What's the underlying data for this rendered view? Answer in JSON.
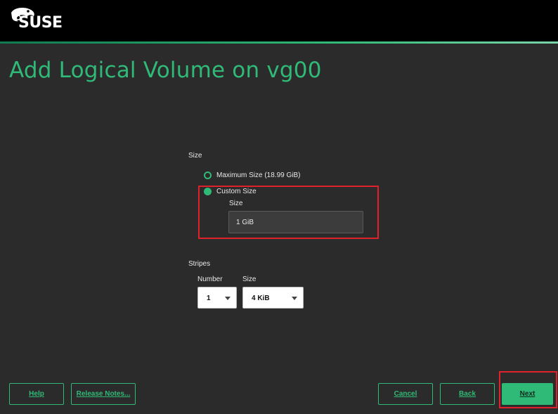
{
  "header": {
    "logo_text": "SUSE",
    "brand_color": "#30ba78"
  },
  "title": "Add Logical Volume on vg00",
  "size_section": {
    "label": "Size",
    "options": [
      {
        "label": "Maximum Size (18.99 GiB)",
        "selected": false
      },
      {
        "label": "Custom Size",
        "selected": true
      }
    ],
    "custom_size_label": "Size",
    "custom_size_value": "1 GiB"
  },
  "stripes_section": {
    "label": "Stripes",
    "number_label": "Number",
    "number_value": "1",
    "size_label": "Size",
    "size_value": "4 KiB"
  },
  "buttons": {
    "help": "Help",
    "release_notes": "Release Notes...",
    "cancel": "Cancel",
    "back": "Back",
    "next": "Next"
  }
}
